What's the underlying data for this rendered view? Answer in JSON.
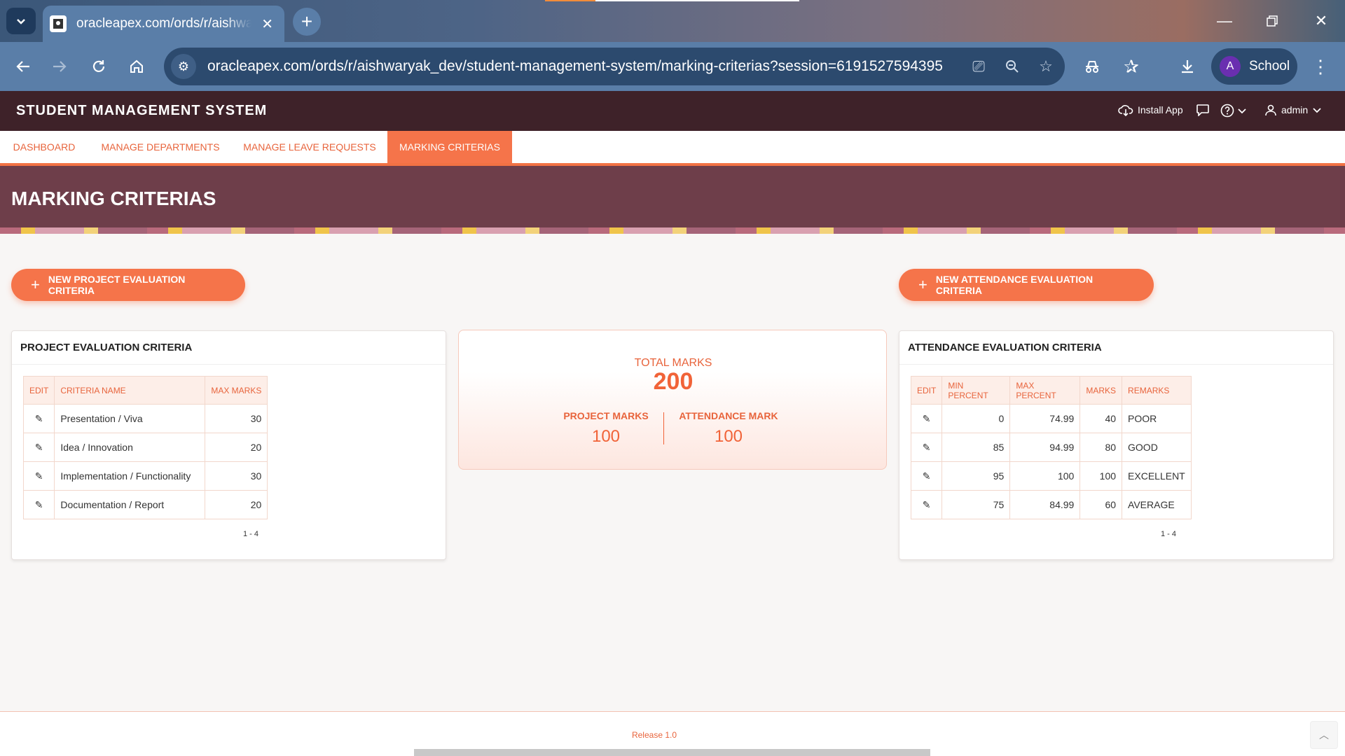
{
  "browser": {
    "tab_title": "oracleapex.com/ords/r/aishwaryak_dev",
    "url": "oracleapex.com/ords/r/aishwaryak_dev/student-management-system/marking-criterias?session=6191527594395",
    "profile_initial": "A",
    "profile_name": "School"
  },
  "app": {
    "title": "STUDENT MANAGEMENT SYSTEM",
    "install_label": "Install App",
    "user_label": "admin"
  },
  "nav": {
    "items": [
      {
        "label": "DASHBOARD"
      },
      {
        "label": "MANAGE DEPARTMENTS"
      },
      {
        "label": "MANAGE LEAVE REQUESTS"
      },
      {
        "label": "MARKING CRITERIAS"
      }
    ],
    "active": "MARKING CRITERIAS"
  },
  "page": {
    "title": "MARKING CRITERIAS",
    "new_project_btn": "NEW PROJECT EVALUATION CRITERIA",
    "new_attendance_btn": "NEW ATTENDANCE EVALUATION CRITERIA"
  },
  "project_table": {
    "title": "PROJECT EVALUATION CRITERIA",
    "headers": [
      "EDIT",
      "CRITERIA NAME",
      "MAX MARKS"
    ],
    "rows": [
      {
        "name": "Presentation / Viva",
        "max": "30"
      },
      {
        "name": "Idea / Innovation",
        "max": "20"
      },
      {
        "name": "Implementation / Functionality",
        "max": "30"
      },
      {
        "name": "Documentation / Report",
        "max": "20"
      }
    ],
    "pagination": "1 - 4"
  },
  "marks": {
    "total_label": "TOTAL MARKS",
    "total_value": "200",
    "project_label": "PROJECT MARKS",
    "project_value": "100",
    "attendance_label": "ATTENDANCE MARK",
    "attendance_value": "100"
  },
  "attendance_table": {
    "title": "ATTENDANCE EVALUATION CRITERIA",
    "headers": [
      "EDIT",
      "MIN PERCENT",
      "MAX PERCENT",
      "MARKS",
      "REMARKS"
    ],
    "rows": [
      {
        "min": "0",
        "max": "74.99",
        "marks": "40",
        "remarks": "POOR"
      },
      {
        "min": "85",
        "max": "94.99",
        "marks": "80",
        "remarks": "GOOD"
      },
      {
        "min": "95",
        "max": "100",
        "marks": "100",
        "remarks": "EXCELLENT"
      },
      {
        "min": "75",
        "max": "84.99",
        "marks": "60",
        "remarks": "AVERAGE"
      }
    ],
    "pagination": "1 - 4"
  },
  "footer": {
    "release": "Release 1.0"
  },
  "colors": {
    "accent": "#f5744a",
    "header": "#3e2229",
    "hero": "#6e3e4a"
  }
}
